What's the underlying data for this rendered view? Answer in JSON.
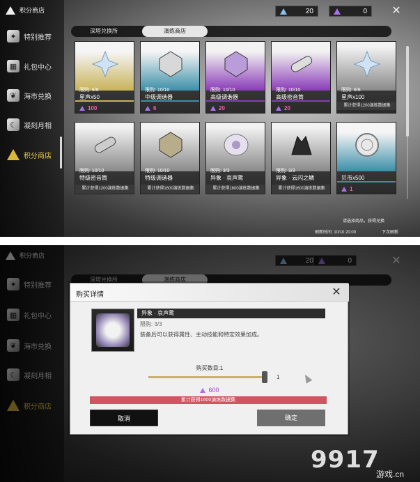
{
  "sidebar": {
    "title": "积分商店",
    "items": [
      {
        "label": "特别推荐",
        "icon": "emblem-icon"
      },
      {
        "label": "礼包中心",
        "icon": "gift-icon"
      },
      {
        "label": "海市兑换",
        "icon": "tree-icon"
      },
      {
        "label": "凝刻月相",
        "icon": "moon-icon"
      },
      {
        "label": "积分商店",
        "icon": "triangle-icon",
        "active": true
      }
    ]
  },
  "currency": {
    "blue": {
      "value": "20",
      "icon": "blue-crystal-icon"
    },
    "purple": {
      "value": "0",
      "icon": "purple-crystal-icon"
    }
  },
  "tabs": [
    "深塔兑换所",
    "演练商店"
  ],
  "cards": [
    {
      "limit": "限购: 6/6",
      "name": "星声x50",
      "price": "100",
      "req": "",
      "rarity": "gold"
    },
    {
      "limit": "限购: 10/10",
      "name": "中级调谐器",
      "price": "6",
      "req": "",
      "rarity": "blue"
    },
    {
      "limit": "限购: 10/10",
      "name": "高级调谐器",
      "price": "20",
      "req": "",
      "rarity": "purple"
    },
    {
      "limit": "限购: 10/10",
      "name": "高级密音筒",
      "price": "20",
      "req": "",
      "rarity": "purple"
    },
    {
      "limit": "限购: 6/6",
      "name": "星声x100",
      "price": "",
      "req": "累计获得1200演练数据集",
      "rarity": "grey"
    },
    {
      "limit": "限购: 10/10",
      "name": "特级密音筒",
      "price": "",
      "req": "累计获得1200演练数据集",
      "rarity": "grey"
    },
    {
      "limit": "限购: 10/10",
      "name": "特级调谐器",
      "price": "",
      "req": "累计获得1600演练数据集",
      "rarity": "grey"
    },
    {
      "limit": "限购: 3/3",
      "name": "异象 · 哀声鸷",
      "price": "",
      "req": "累计获得1600演练数据集",
      "rarity": "grey"
    },
    {
      "limit": "限购: 3/3",
      "name": "异象 · 云闪之鳞",
      "price": "",
      "req": "累计获得1600演练数据集",
      "rarity": "grey"
    },
    {
      "limit": "",
      "name": "贝币x500",
      "price": "1",
      "req": "",
      "rarity": "blue"
    }
  ],
  "notes": {
    "note1": "请选择商品，获得兑换",
    "note2": "刷新时间: 10/10 20:00",
    "note3": "下次刷新"
  },
  "dialog": {
    "title": "购买详情",
    "item_name": "异象 · 哀声鸷",
    "limit": "限购: 3/3",
    "description": "装备后可以获得属性、主动技能和特定效果加成。",
    "quantity_label": "购买数目:1",
    "slider_value": "1",
    "price": "600",
    "requirement": "累计获得1600演练数据集",
    "cancel": "取消",
    "confirm": "确定"
  },
  "watermark": {
    "main": "9917",
    "sub": "游戏.cn"
  }
}
